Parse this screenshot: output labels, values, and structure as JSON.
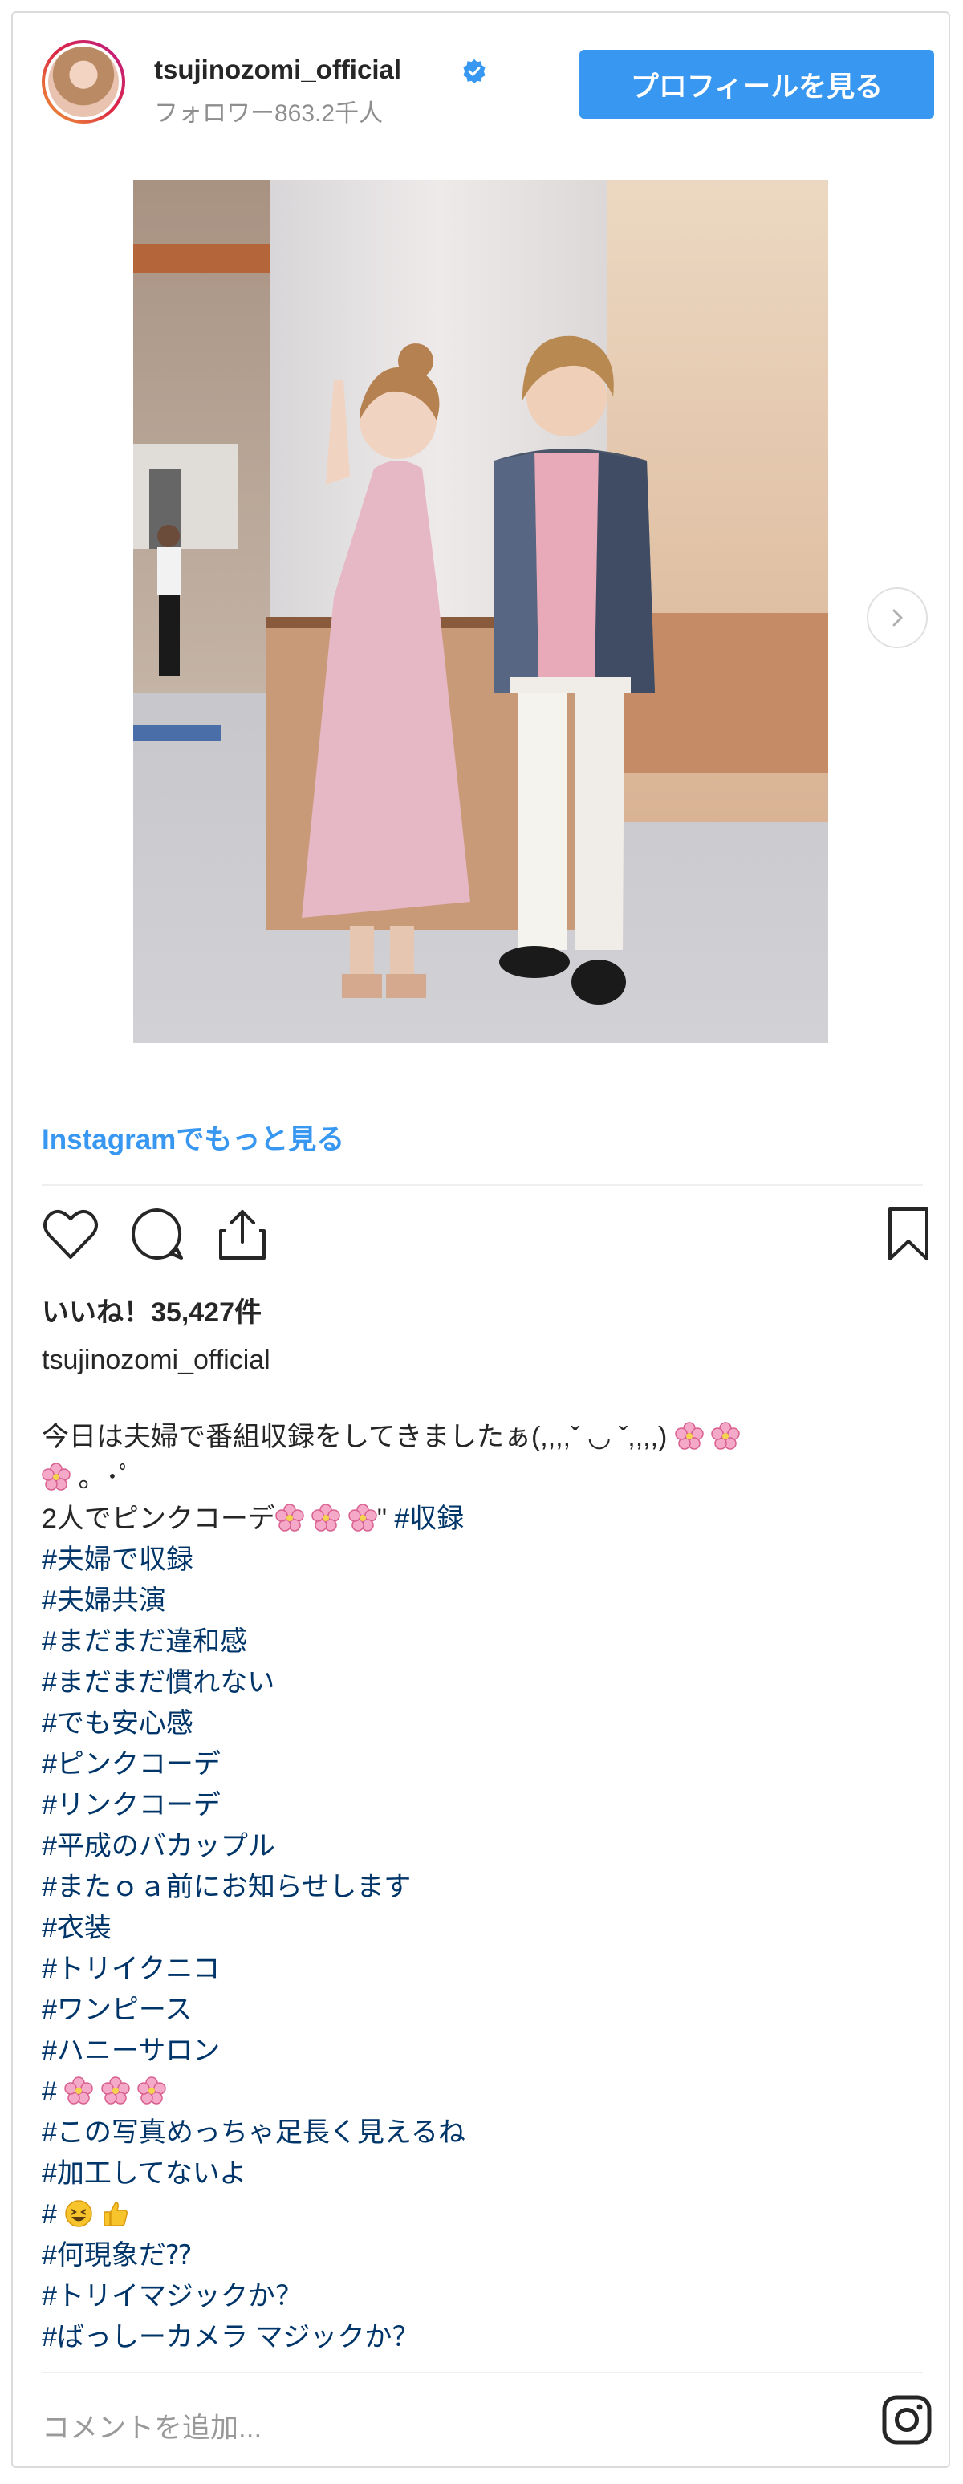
{
  "header": {
    "username": "tsujinozomi_official",
    "followers": "フォロワー863.2千人",
    "profile_button": "プロフィールを見る"
  },
  "post": {
    "see_more": "Instagramでもっと見る",
    "likes": "いいね！35,427件",
    "author": "tsujinozomi_official"
  },
  "caption": {
    "line1": "今日は夫婦で番組収録をしてきましたぁ(,,,,ˇ ◡ ˇ,,,,)",
    "line2": "。･ﾟ",
    "line3_text": "2人でピンクコーデ",
    "line3_tail": "\"",
    "line3_tag": "#収録",
    "tags": [
      "#夫婦で収録",
      "#夫婦共演",
      "#まだまだ違和感",
      "#まだまだ慣れない",
      "#でも安心感",
      "#ピンクコーデ",
      "#リンクコーデ",
      "#平成のバカップル",
      "#またｏａ前にお知らせします",
      "#衣装",
      "#トリイクニコ",
      "#ワンピース",
      "#ハニーサロン"
    ],
    "flower_tag": "#",
    "tags2": [
      "#この写真めっちゃ足長く見えるね",
      "#加工してないよ"
    ],
    "emoji_tag": "#",
    "tags3": [
      "#何現象だ⁇",
      "#トリイマジックか？",
      "#ばっしーカメラ マジックか？"
    ]
  },
  "comment": {
    "placeholder": "コメントを追加..."
  },
  "colors": {
    "accent": "#3897f0",
    "text": "#262626",
    "muted": "#8e8e8e",
    "hashtag": "#003569"
  },
  "icons": [
    "verified-badge-icon",
    "next-arrow-icon",
    "heart-icon",
    "comment-icon",
    "share-icon",
    "bookmark-icon",
    "flower-emoji-icon",
    "laugh-emoji-icon",
    "thumbs-up-icon",
    "instagram-logo-icon"
  ]
}
